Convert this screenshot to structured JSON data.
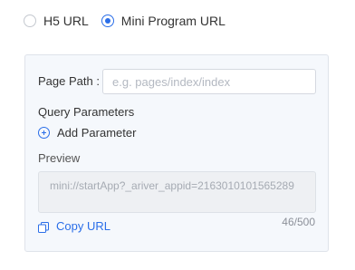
{
  "url_type": {
    "options": [
      {
        "label": "H5 URL",
        "checked": false
      },
      {
        "label": "Mini Program URL",
        "checked": true
      }
    ]
  },
  "form": {
    "page_path_label": "Page Path :",
    "page_path_value": "",
    "page_path_placeholder": "e.g. pages/index/index",
    "query_params_label": "Query Parameters",
    "add_param_label": "Add Parameter",
    "preview_label": "Preview",
    "preview_text": "mini://startApp?_ariver_appid=2163010101565289",
    "copy_url_label": "Copy URL",
    "char_count": "46/500"
  },
  "colors": {
    "accent": "#2a6ee8",
    "panel_bg": "#f5f8fc",
    "placeholder": "#b3b8c1"
  },
  "icons": {
    "add": "plus-circle-icon",
    "copy": "copy-icon"
  }
}
